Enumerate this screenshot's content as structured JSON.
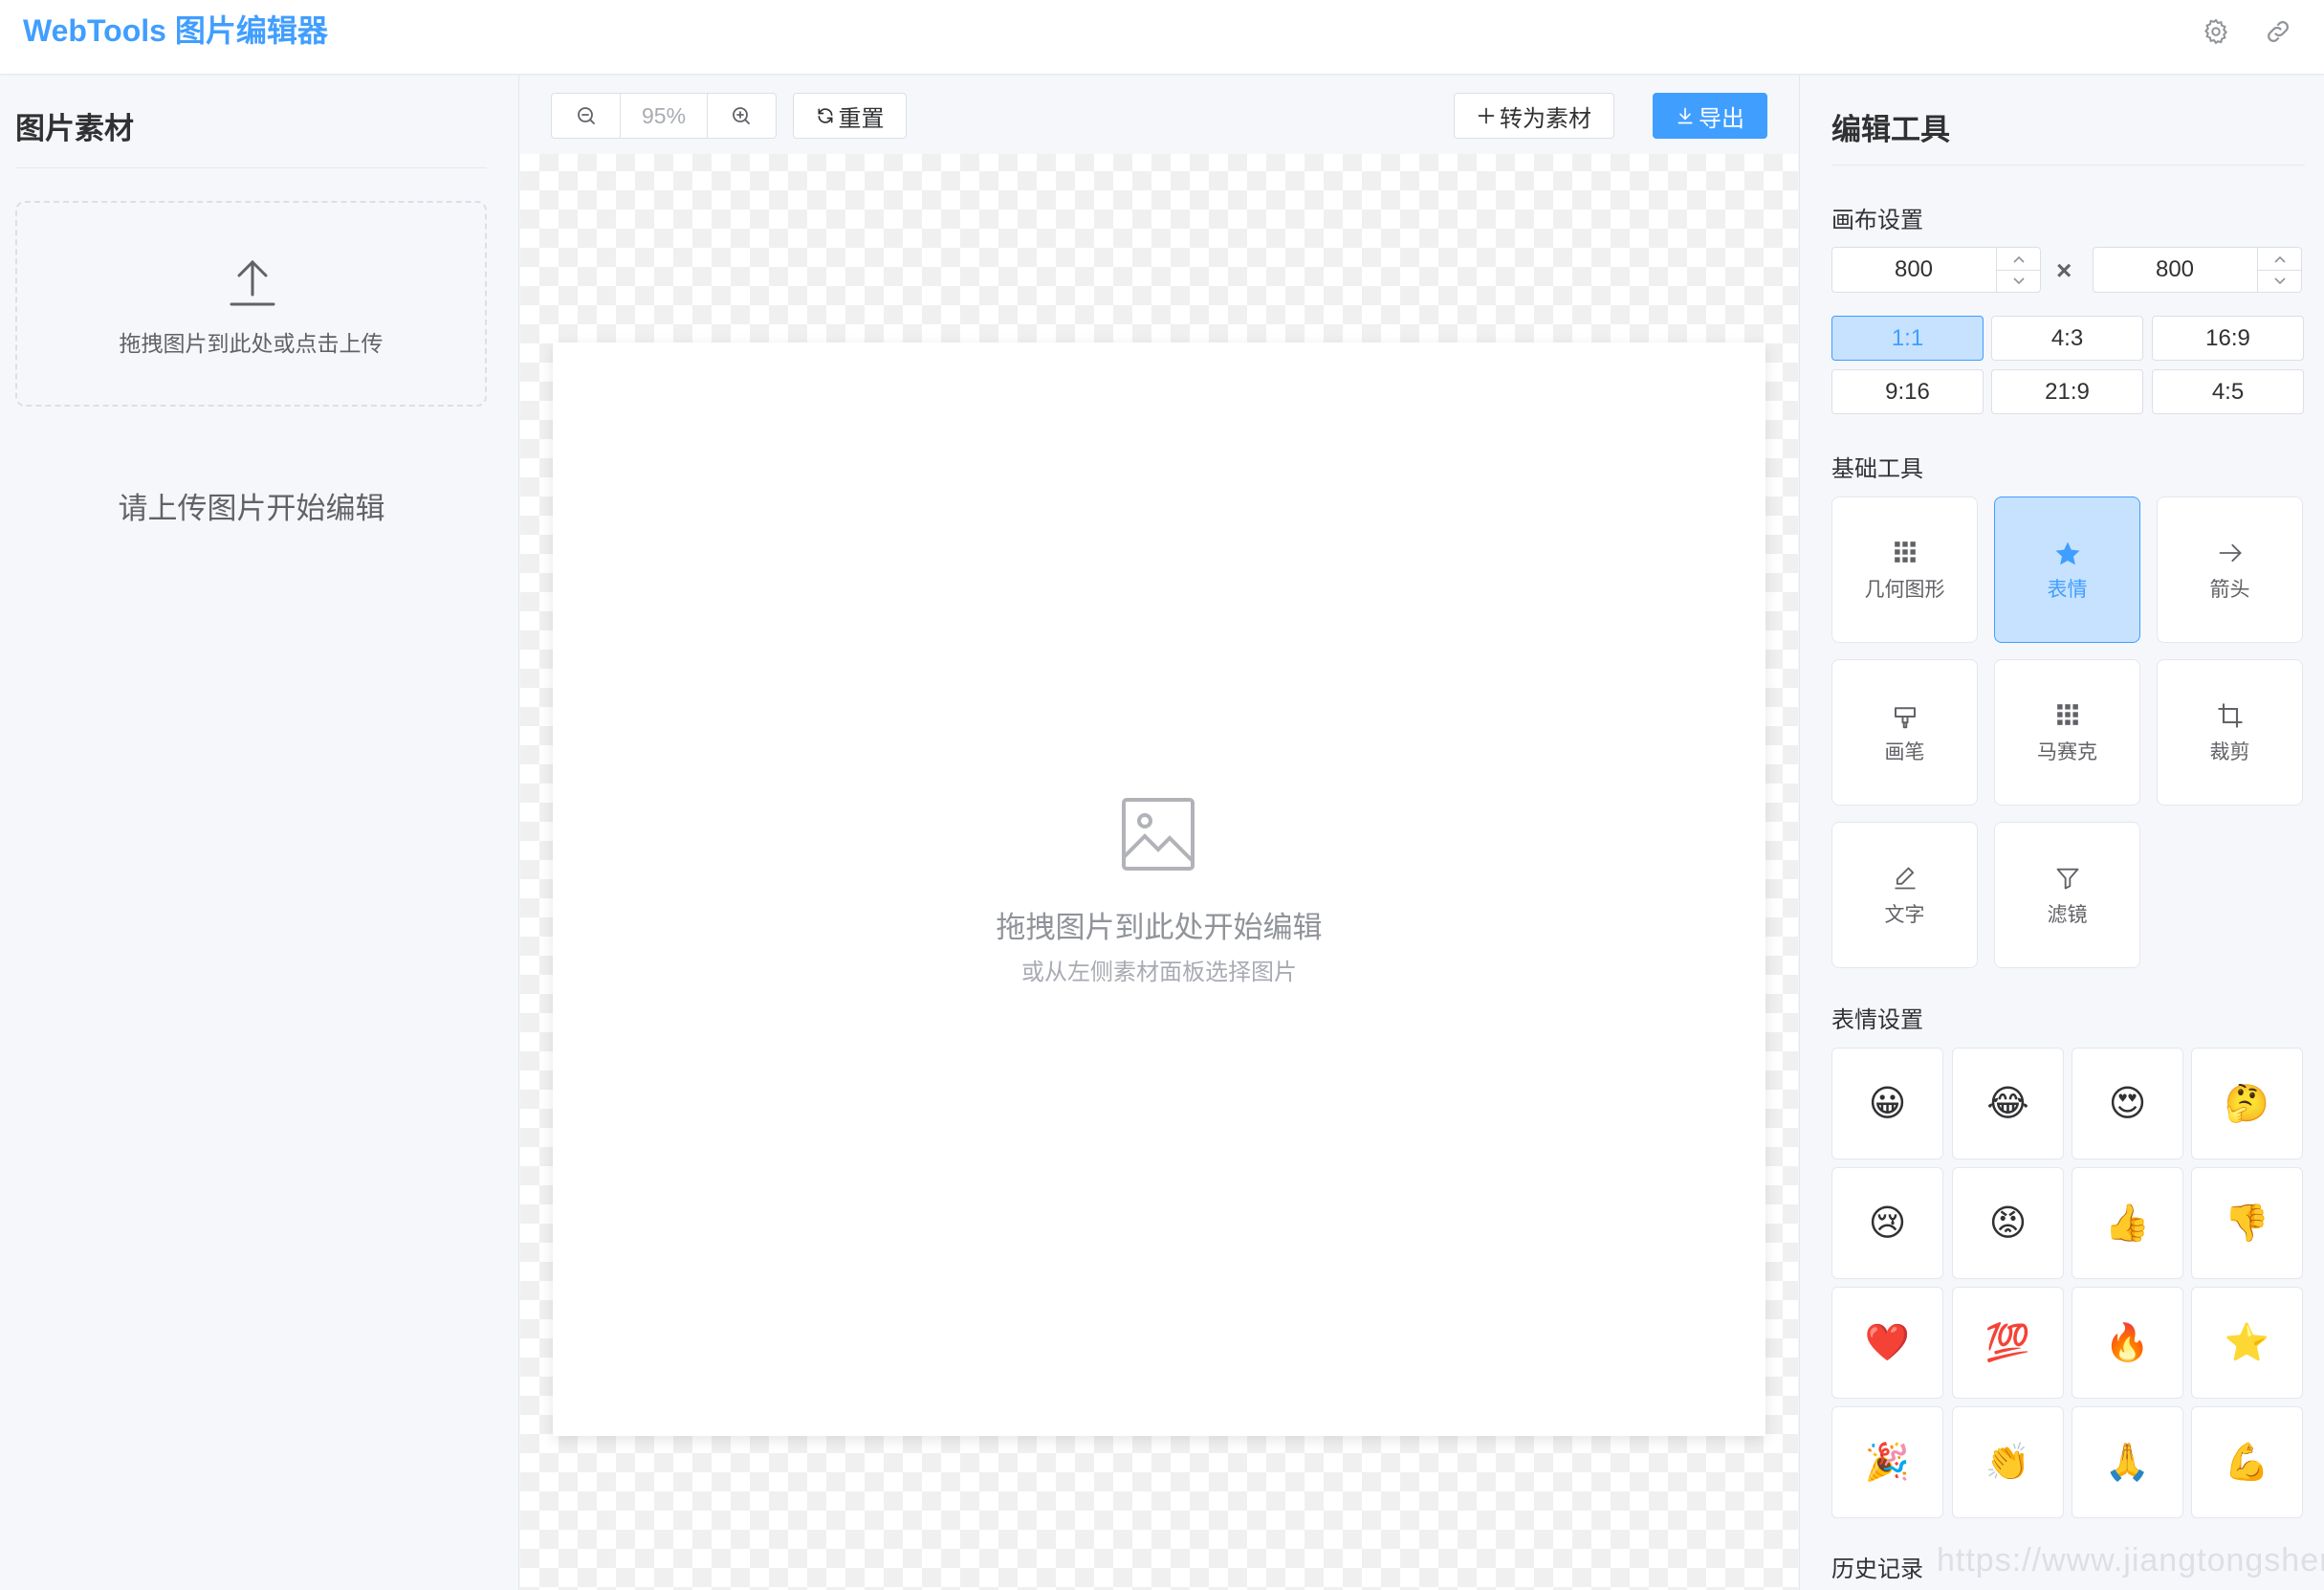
{
  "header": {
    "title": "WebTools 图片编辑器",
    "icons": [
      "gear-icon",
      "link-icon"
    ]
  },
  "left_panel": {
    "title": "图片素材",
    "upload_text": "拖拽图片到此处或点击上传",
    "empty_text": "请上传图片开始编辑"
  },
  "toolbar": {
    "zoom_value": "95%",
    "reset_label": "重置",
    "to_material_label": "转为素材",
    "export_label": "导出"
  },
  "canvas": {
    "placeholder_title": "拖拽图片到此处开始编辑",
    "placeholder_sub": "或从左侧素材面板选择图片"
  },
  "right_panel": {
    "title": "编辑工具",
    "canvas_settings": {
      "title": "画布设置",
      "width": "800",
      "height": "800",
      "times": "×",
      "ratios": [
        "1:1",
        "4:3",
        "16:9",
        "9:16",
        "21:9",
        "4:5"
      ],
      "active_ratio": "1:1"
    },
    "basic_tools": {
      "title": "基础工具",
      "items": [
        {
          "label": "几何图形",
          "icon": "grid-icon"
        },
        {
          "label": "表情",
          "icon": "star-icon"
        },
        {
          "label": "箭头",
          "icon": "arrow-right-icon"
        },
        {
          "label": "画笔",
          "icon": "brush-icon"
        },
        {
          "label": "马赛克",
          "icon": "mosaic-icon"
        },
        {
          "label": "裁剪",
          "icon": "crop-icon"
        },
        {
          "label": "文字",
          "icon": "pen-icon"
        },
        {
          "label": "滤镜",
          "icon": "filter-icon"
        }
      ],
      "active": "表情"
    },
    "emoji_settings": {
      "title": "表情设置",
      "emojis": [
        "😀",
        "😂",
        "😍",
        "🤔",
        "😢",
        "😡",
        "👍",
        "👎",
        "❤️",
        "💯",
        "🔥",
        "⭐",
        "🎉",
        "👏",
        "🙏",
        "💪"
      ]
    },
    "history": {
      "title": "历史记录"
    }
  },
  "watermark": "https://www.jiangtongsheng.com",
  "colors": {
    "accent": "#409eff",
    "accent_light": "#c6e2ff",
    "border": "#dcdfe6",
    "text": "#303133"
  }
}
